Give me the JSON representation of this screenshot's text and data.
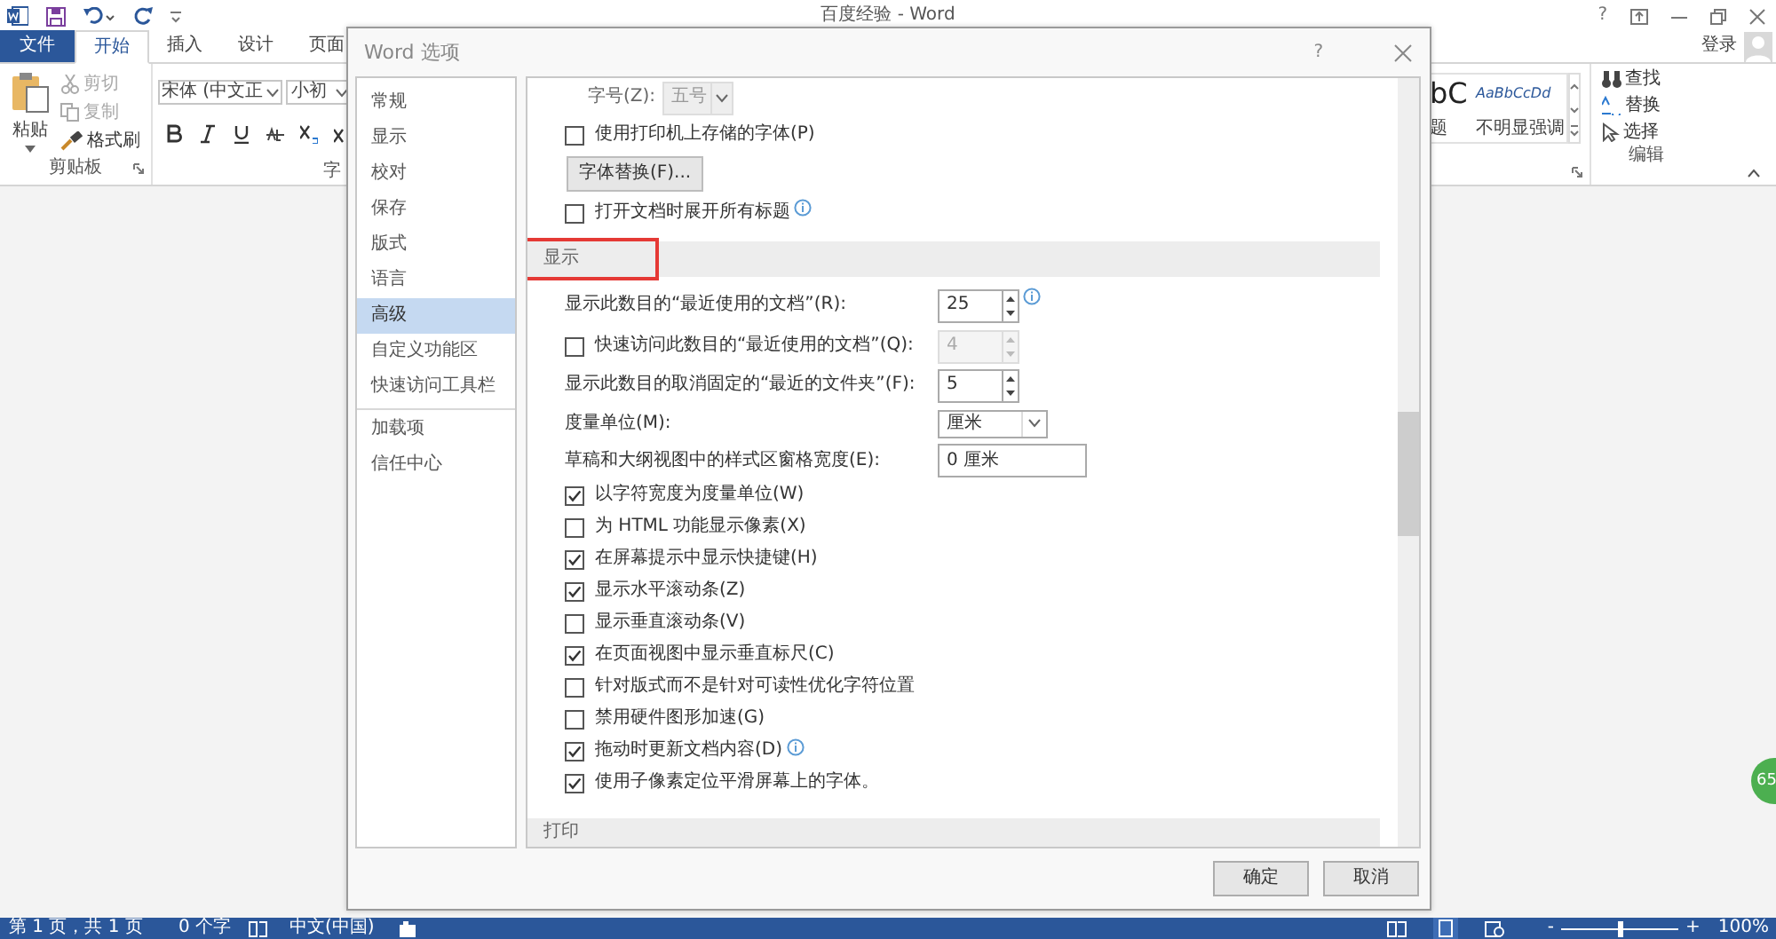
{
  "app": {
    "title": "百度经验 - Word",
    "help": "?",
    "sign_in": "登录",
    "tabs": [
      {
        "label": "文件",
        "kind": "file",
        "selected": false
      },
      {
        "label": "开始",
        "kind": "tab",
        "selected": true
      },
      {
        "label": "插入",
        "kind": "tab",
        "selected": false
      },
      {
        "label": "设计",
        "kind": "tab",
        "selected": false
      },
      {
        "label": "页面",
        "kind": "tab",
        "selected": false
      }
    ],
    "clipboard": {
      "paste": "粘贴",
      "cut": "剪切",
      "copy": "复制",
      "format_painter": "格式刷",
      "group_label": "剪贴板",
      "cut_disabled": true,
      "copy_disabled": true
    },
    "font": {
      "font_name": "宋体 (中文正",
      "font_size": "小初",
      "group_label": "字"
    },
    "styles": {
      "preview_1": "bC",
      "preview_2": "AaBbCcDd",
      "name_1": "题",
      "name_2": "不明显强调"
    },
    "editing": {
      "find": "查找",
      "replace": "替换",
      "select": "选择",
      "group_label": "编辑"
    },
    "badge": "65",
    "status_bar": {
      "page": "第 1 页，共 1 页",
      "words": "0 个字",
      "language": "中文(中国)",
      "zoom": "100%",
      "zoom_out": "-",
      "zoom_in": "+",
      "zoom_slider": {
        "level": 0.5
      }
    }
  },
  "dialog": {
    "title": "Word 选项",
    "help": "?",
    "nav": [
      {
        "label": "常规",
        "selected": false,
        "divider_above": false
      },
      {
        "label": "显示",
        "selected": false,
        "divider_above": false
      },
      {
        "label": "校对",
        "selected": false,
        "divider_above": false
      },
      {
        "label": "保存",
        "selected": false,
        "divider_above": false
      },
      {
        "label": "版式",
        "selected": false,
        "divider_above": false
      },
      {
        "label": "语言",
        "selected": false,
        "divider_above": false
      },
      {
        "label": "高级",
        "selected": true,
        "divider_above": false
      },
      {
        "label": "自定义功能区",
        "selected": false,
        "divider_above": false
      },
      {
        "label": "快速访问工具栏",
        "selected": false,
        "divider_above": false
      },
      {
        "label": "加载项",
        "selected": false,
        "divider_above": true
      },
      {
        "label": "信任中心",
        "selected": false,
        "divider_above": false
      }
    ],
    "options": [
      {
        "kind": "dropdown",
        "label": "字号(Z):",
        "value": "五号",
        "disabled": true
      },
      {
        "kind": "checkbox",
        "label": "使用打印机上存储的字体(P)",
        "checked": false,
        "info": false
      },
      {
        "kind": "button",
        "label": "字体替换(F)..."
      },
      {
        "kind": "checkbox",
        "label": "打开文档时展开所有标题",
        "checked": false,
        "info": true
      },
      {
        "kind": "section",
        "label": "显示",
        "highlighted": true
      },
      {
        "kind": "spin",
        "label": "显示此数目的“最近使用的文档”(R):",
        "value": "25",
        "disabled": false,
        "info": true
      },
      {
        "kind": "spin",
        "label": "快速访问此数目的“最近使用的文档”(Q):",
        "value": "4",
        "disabled": true,
        "checked": false,
        "info": false
      },
      {
        "kind": "spin",
        "label": "显示此数目的取消固定的“最近的文件夹”(F):",
        "value": "5",
        "disabled": false,
        "info": false
      },
      {
        "kind": "select",
        "label": "度量单位(M):",
        "value": "厘米"
      },
      {
        "kind": "text",
        "label": "草稿和大纲视图中的样式区窗格宽度(E):",
        "value": "0 厘米"
      },
      {
        "kind": "checkbox",
        "label": "以字符宽度为度量单位(W)",
        "checked": true,
        "info": false
      },
      {
        "kind": "checkbox",
        "label": "为 HTML 功能显示像素(X)",
        "checked": false,
        "info": false
      },
      {
        "kind": "checkbox",
        "label": "在屏幕提示中显示快捷键(H)",
        "checked": true,
        "info": false
      },
      {
        "kind": "checkbox",
        "label": "显示水平滚动条(Z)",
        "checked": true,
        "info": false
      },
      {
        "kind": "checkbox",
        "label": "显示垂直滚动条(V)",
        "checked": false,
        "info": false
      },
      {
        "kind": "checkbox",
        "label": "在页面视图中显示垂直标尺(C)",
        "checked": true,
        "info": false
      },
      {
        "kind": "checkbox",
        "label": "针对版式而不是针对可读性优化字符位置",
        "checked": false,
        "info": false
      },
      {
        "kind": "checkbox",
        "label": "禁用硬件图形加速(G)",
        "checked": false,
        "info": false
      },
      {
        "kind": "checkbox",
        "label": "拖动时更新文档内容(D)",
        "checked": true,
        "info": true
      },
      {
        "kind": "checkbox",
        "label": "使用子像素定位平滑屏幕上的字体。",
        "checked": true,
        "info": false
      },
      {
        "kind": "section",
        "label": "打印",
        "highlighted": false
      }
    ],
    "buttons": [
      {
        "label": "确定"
      },
      {
        "label": "取消"
      }
    ]
  }
}
